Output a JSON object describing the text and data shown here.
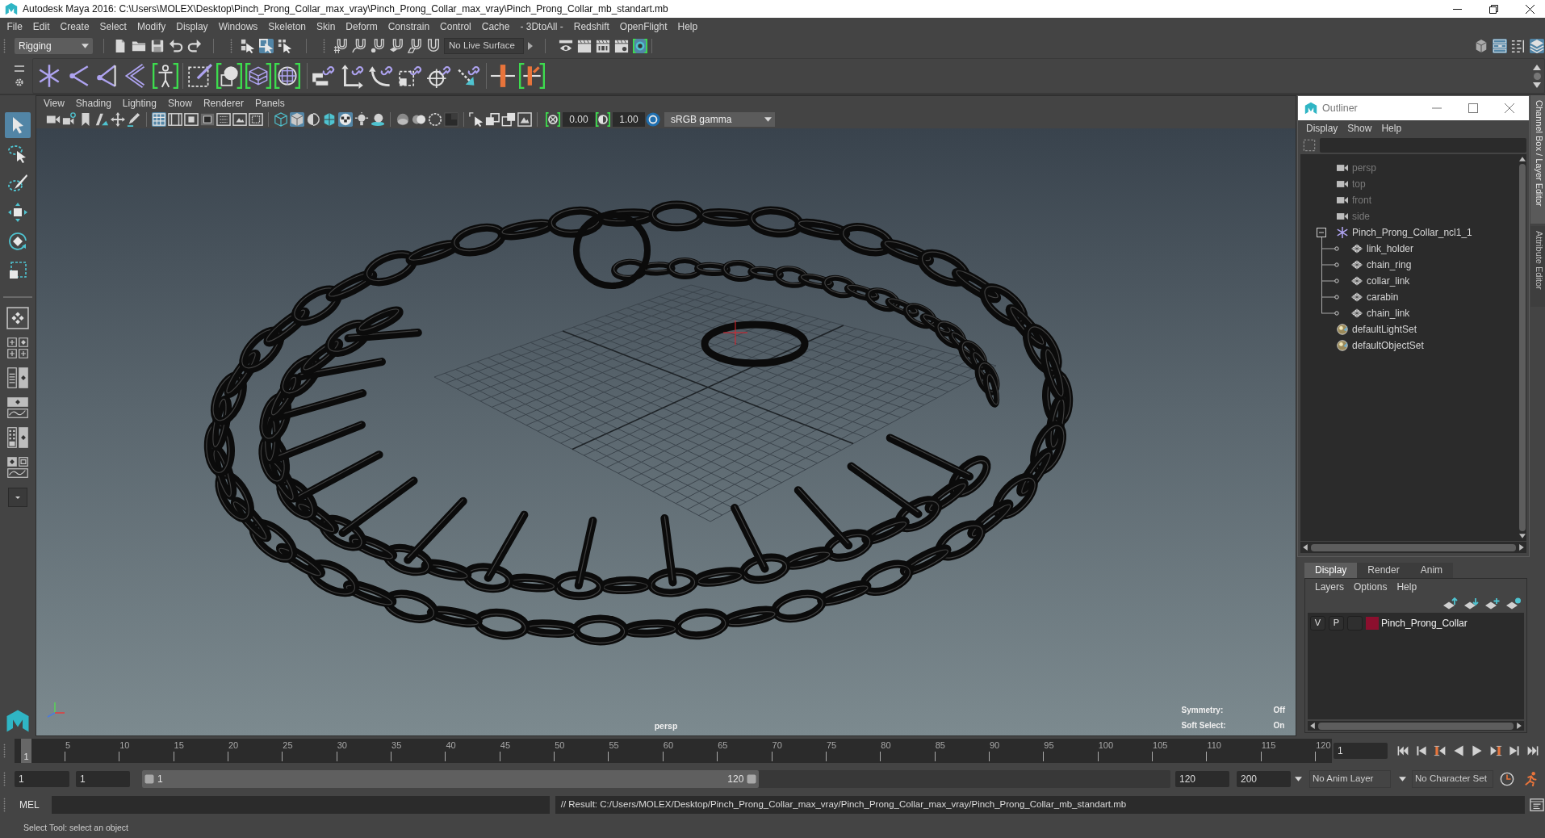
{
  "window": {
    "title": "Autodesk Maya 2016: C:\\Users\\MOLEX\\Desktop\\Pinch_Prong_Collar_max_vray\\Pinch_Prong_Collar_max_vray\\Pinch_Prong_Collar_mb_standart.mb"
  },
  "menu_bar": [
    "File",
    "Edit",
    "Create",
    "Select",
    "Modify",
    "Display",
    "Windows",
    "Skeleton",
    "Skin",
    "Deform",
    "Constrain",
    "Control",
    "Cache",
    "- 3DtoAll -",
    "Redshift",
    "OpenFlight",
    "Help"
  ],
  "status_line": {
    "menu_set": "Rigging",
    "file_tools": [
      {
        "kind": "new",
        "on": false
      },
      {
        "kind": "open",
        "on": false
      },
      {
        "kind": "save",
        "on": false
      },
      {
        "kind": "undo",
        "on": false
      },
      {
        "kind": "redo",
        "on": false
      }
    ],
    "select_tools": [
      {
        "kind": "hierarchy",
        "on": false
      },
      {
        "kind": "object",
        "on": true
      },
      {
        "kind": "component",
        "on": false
      }
    ],
    "snap_tools": [
      {
        "kind": "snapgrid",
        "on": false
      },
      {
        "kind": "snapcurve",
        "on": false
      },
      {
        "kind": "snappoint",
        "on": false
      },
      {
        "kind": "snapplane",
        "on": false
      },
      {
        "kind": "live",
        "on": false
      },
      {
        "kind": "magnet",
        "on": false
      }
    ],
    "live_surface": "No Live Surface",
    "render_tools": [
      {
        "kind": "renderview",
        "on": false
      },
      {
        "kind": "render",
        "on": false
      },
      {
        "kind": "ipr",
        "on": false
      },
      {
        "kind": "rendersettings",
        "on": false
      },
      {
        "kind": "hypershade",
        "on": true
      }
    ],
    "panel_tools": [
      {
        "kind": "toolkit",
        "on": false
      },
      {
        "kind": "attributes",
        "on": true
      },
      {
        "kind": "toolsettings",
        "on": false
      },
      {
        "kind": "channelbox",
        "on": true
      }
    ]
  },
  "toolbox": {
    "tools": [
      {
        "kind": "select",
        "selected": true
      },
      {
        "kind": "lasso",
        "selected": false
      },
      {
        "kind": "paint",
        "selected": false
      },
      {
        "kind": "move",
        "selected": false
      },
      {
        "kind": "rotate",
        "selected": false
      },
      {
        "kind": "scale",
        "selected": false
      }
    ],
    "layouts": [
      {
        "kind": "single",
        "selected": true
      },
      {
        "kind": "quad",
        "selected": false
      },
      {
        "kind": "outliner",
        "selected": false
      },
      {
        "kind": "graph",
        "selected": false
      },
      {
        "kind": "hypershade",
        "selected": false
      },
      {
        "kind": "mixed",
        "selected": false
      }
    ]
  },
  "viewport": {
    "menu": [
      "View",
      "Shading",
      "Lighting",
      "Show",
      "Renderer",
      "Panels"
    ],
    "toolbar": [
      [
        {
          "kind": "camera",
          "on": false
        },
        {
          "kind": "cameralock",
          "on": false
        },
        {
          "kind": "bookmark",
          "on": false
        },
        {
          "kind": "imageplane",
          "on": false
        },
        {
          "kind": "pan",
          "on": false
        },
        {
          "kind": "pencil",
          "on": false
        }
      ],
      [
        {
          "kind": "grid",
          "on": true
        },
        {
          "kind": "filmgate",
          "on": false
        },
        {
          "kind": "resolutiongate",
          "on": false
        },
        {
          "kind": "gatemask",
          "on": false
        },
        {
          "kind": "fieldchart",
          "on": false
        },
        {
          "kind": "safeaction",
          "on": false
        },
        {
          "kind": "safetitle",
          "on": false
        }
      ],
      [
        {
          "kind": "wireframe",
          "on": false
        },
        {
          "kind": "smooth",
          "on": true
        },
        {
          "kind": "wireonshaded",
          "on": false
        },
        {
          "kind": "textured",
          "on": false
        },
        {
          "kind": "lights",
          "on": true
        },
        {
          "kind": "bulb",
          "on": false
        },
        {
          "kind": "shadows",
          "on": false
        }
      ],
      [
        {
          "kind": "xray",
          "on": false
        },
        {
          "kind": "occlusion",
          "on": false
        },
        {
          "kind": "depth",
          "on": false
        },
        {
          "kind": "dark",
          "on": false
        }
      ],
      [
        {
          "kind": "isolate",
          "on": false
        },
        {
          "kind": "overlap",
          "on": false
        },
        {
          "kind": "frame",
          "on": false
        },
        {
          "kind": "picture",
          "on": false
        }
      ]
    ],
    "exposure": "0.00",
    "gamma": "1.00",
    "color_management": true,
    "color_space": "sRGB gamma",
    "camera": "persp",
    "hud": [
      {
        "label": "Symmetry:",
        "value": "Off"
      },
      {
        "label": "Soft Select:",
        "value": "On"
      }
    ]
  },
  "outliner": {
    "title": "Outliner",
    "menu": [
      "Display",
      "Show",
      "Help"
    ],
    "items": [
      {
        "kind": "camera",
        "label": "persp",
        "dimmed": true
      },
      {
        "kind": "camera",
        "label": "top",
        "dimmed": true
      },
      {
        "kind": "camera",
        "label": "front",
        "dimmed": true
      },
      {
        "kind": "camera",
        "label": "side",
        "dimmed": true
      },
      {
        "kind": "group",
        "label": "Pinch_Prong_Collar_ncl1_1",
        "dimmed": false,
        "expanded": true,
        "children": [
          {
            "kind": "mesh",
            "label": "link_holder",
            "dimmed": false
          },
          {
            "kind": "mesh",
            "label": "chain_ring",
            "dimmed": false
          },
          {
            "kind": "mesh",
            "label": "collar_link",
            "dimmed": false
          },
          {
            "kind": "mesh",
            "label": "carabin",
            "dimmed": false
          },
          {
            "kind": "mesh",
            "label": "chain_link",
            "dimmed": false
          }
        ]
      },
      {
        "kind": "set",
        "label": "defaultLightSet",
        "dimmed": false
      },
      {
        "kind": "set",
        "label": "defaultObjectSet",
        "dimmed": false
      }
    ]
  },
  "layer_editor": {
    "tabs": [
      {
        "label": "Display",
        "selected": true
      },
      {
        "label": "Render",
        "selected": false
      },
      {
        "label": "Anim",
        "selected": false
      }
    ],
    "menu": [
      "Layers",
      "Options",
      "Help"
    ],
    "layers": [
      {
        "visibility": "V",
        "playback": "P",
        "name": "Pinch_Prong_Collar",
        "color": "#8c0f2e"
      }
    ]
  },
  "side_tabs": [
    {
      "label": "Channel Box / Layer Editor",
      "selected": true
    },
    {
      "label": "Attribute Editor",
      "selected": false
    }
  ],
  "timeline": {
    "current_frame": "1",
    "ticks": [
      "5",
      "10",
      "15",
      "20",
      "25",
      "30",
      "35",
      "40",
      "45",
      "50",
      "55",
      "60",
      "65",
      "70",
      "75",
      "80",
      "85",
      "90",
      "95",
      "100",
      "105",
      "110",
      "115",
      "120"
    ],
    "current_time": "1"
  },
  "range": {
    "start": "1",
    "playback_start": "1",
    "range_start": "1",
    "range_end": "120",
    "level": 0.6,
    "playback_end": "120",
    "end": "200"
  },
  "anim_layer": "No Anim Layer",
  "character_set": "No Character Set",
  "command_line": {
    "language": "MEL",
    "result": "// Result: C:/Users/MOLEX/Desktop/Pinch_Prong_Collar_max_vray/Pinch_Prong_Collar_max_vray/Pinch_Prong_Collar_mb_standart.mb"
  },
  "help_line": "Select Tool: select an object"
}
